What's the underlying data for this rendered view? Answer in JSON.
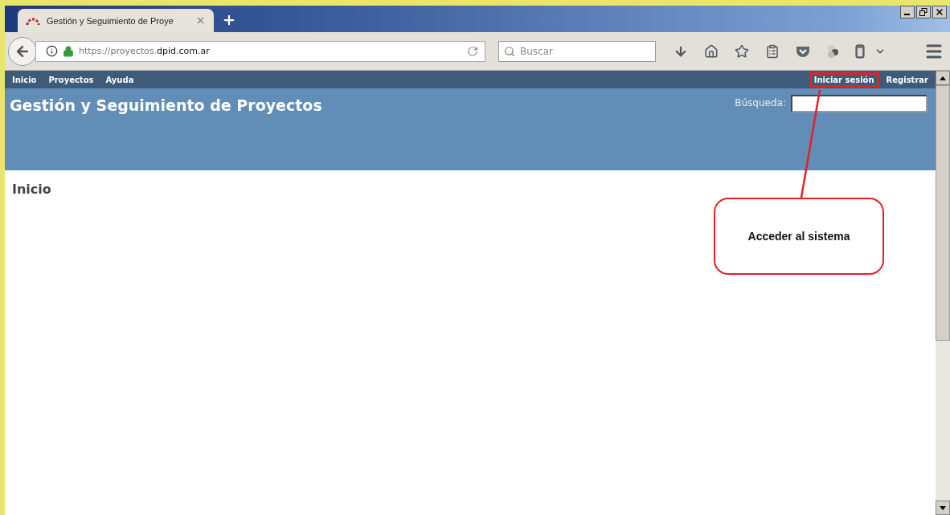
{
  "browser": {
    "tab_title": "Gestión y Seguimiento de Proye",
    "url_host": "https://proyectos.",
    "url_domain": "dpid.com.ar",
    "search_placeholder": "Buscar"
  },
  "nav": {
    "left": [
      {
        "label": "Inicio"
      },
      {
        "label": "Proyectos"
      },
      {
        "label": "Ayuda"
      }
    ],
    "right": [
      {
        "label": "Iniciar sesión",
        "highlighted": true
      },
      {
        "label": "Registrar",
        "highlighted": false
      }
    ]
  },
  "header": {
    "title": "Gestión y Seguimiento de Proyectos",
    "search_label": "Búsqueda:"
  },
  "page_heading": "Inicio",
  "callout": {
    "text": "Acceder al sistema"
  }
}
